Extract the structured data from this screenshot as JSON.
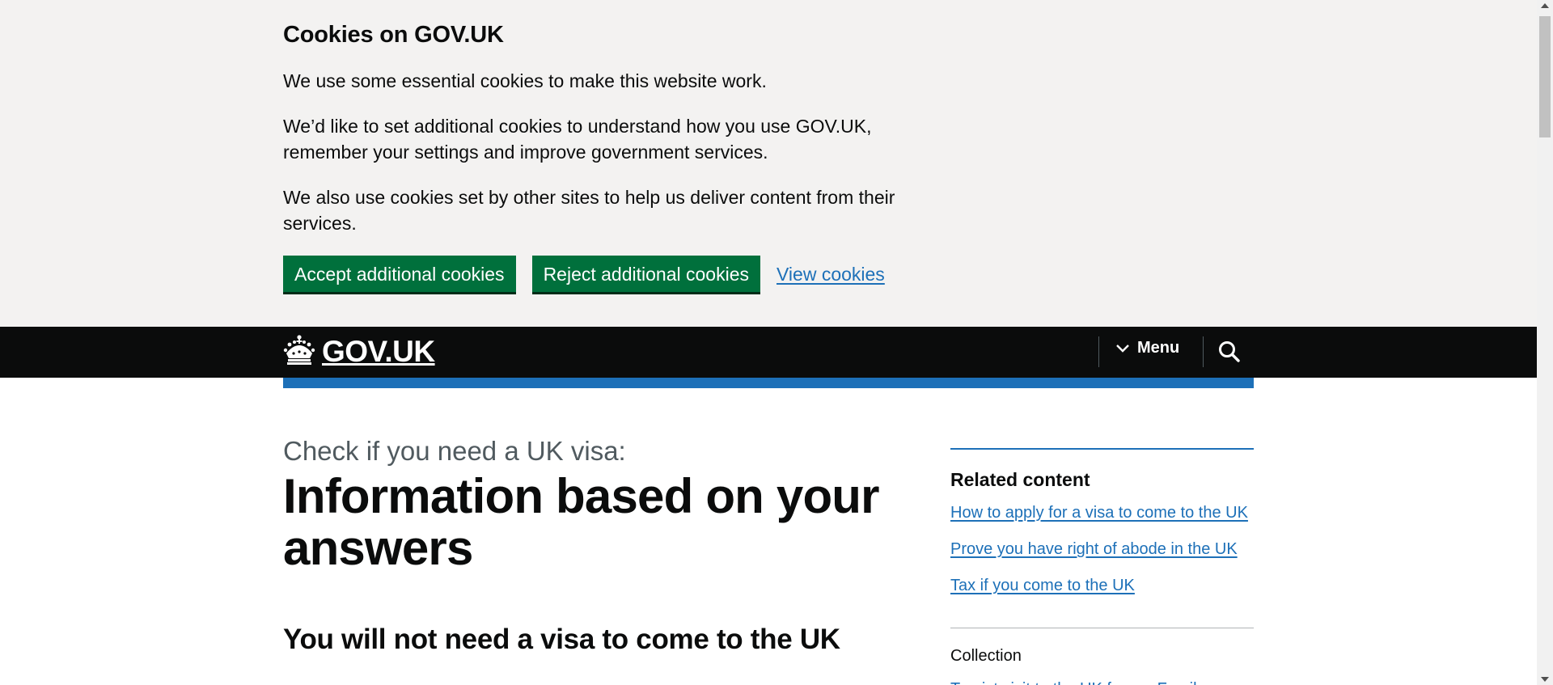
{
  "cookie_banner": {
    "title": "Cookies on GOV.UK",
    "paragraphs": [
      "We use some essential cookies to make this website work.",
      "We’d like to set additional cookies to understand how you use GOV.UK, remember your settings and improve government services.",
      "We also use cookies set by other sites to help us deliver content from their services."
    ],
    "accept_label": "Accept additional cookies",
    "reject_label": "Reject additional cookies",
    "view_label": "View cookies"
  },
  "header": {
    "logo_text": "GOV.UK",
    "menu_label": "Menu",
    "icons": {
      "logo": "crown-icon",
      "menu": "chevron-down-icon",
      "search": "search-icon"
    }
  },
  "main": {
    "caption": "Check if you need a UK visa:",
    "title": "Information based on your answers",
    "subtitle": "You will not need a visa to come to the UK"
  },
  "related": {
    "title": "Related content",
    "links": [
      "How to apply for a visa to come to the UK",
      "Prove you have right of abode in the UK",
      "Tax if you come to the UK"
    ],
    "collection_label": "Collection",
    "collection_link": "Tourist visit to the UK from a Family"
  },
  "colors": {
    "banner_bg": "#f3f2f1",
    "header_bg": "#0b0c0c",
    "brand_blue": "#1d70b8",
    "button_green": "#00703c",
    "text": "#0b0c0c",
    "secondary_text": "#505a5f"
  }
}
